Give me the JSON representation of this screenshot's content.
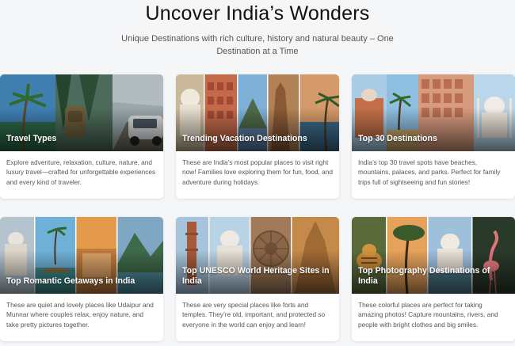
{
  "header": {
    "title": "Uncover India’s Wonders",
    "subtitle": "Unique Destinations with rich culture, history and natural beauty – One Destination at a Time"
  },
  "cards": [
    {
      "label": "Travel Types",
      "description": "Explore adventure, relaxation, culture, nature, and luxury travel—crafted for unforgettable experiences and every kind of traveler.",
      "image": "travel-types-collage"
    },
    {
      "label": "Trending Vacation Destinations",
      "description": "These are India’s most popular places to visit right now! Families love exploring them for fun, food, and adventure during holidays.",
      "image": "trending-destinations-collage"
    },
    {
      "label": "Top 30 Destinations",
      "description": "India’s top 30 travel spots have beaches, mountains, palaces, and parks. Perfect for family trips full of sightseeing and fun stories!",
      "image": "top-30-collage"
    },
    {
      "label": "Top Romantic Getaways in India",
      "description": "These are quiet and lovely places like Udaipur and Munnar where couples relax, enjoy nature, and take pretty pictures together.",
      "image": "romantic-getaways-collage"
    },
    {
      "label": "Top UNESCO World Heritage Sites in India",
      "description": "These are very special places like forts and temples. They’re old, important, and protected so everyone in the world can enjoy and learn!",
      "image": "unesco-sites-collage"
    },
    {
      "label": "Top Photography Destinations of India",
      "description": "These colorful places are perfect for taking amazing photos! Capture mountains, rivers, and people with bright clothes and big smiles.",
      "image": "photography-collage"
    }
  ]
}
